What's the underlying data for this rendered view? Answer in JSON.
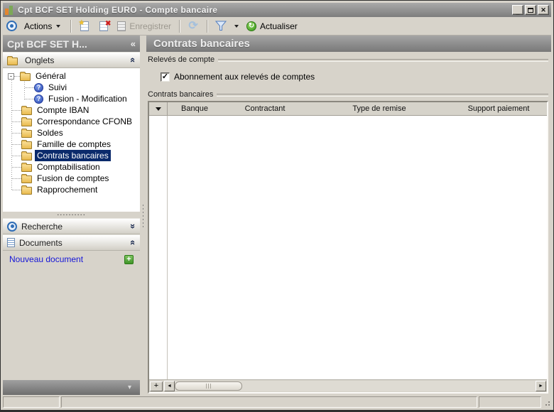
{
  "window": {
    "title": "Cpt BCF SET Holding EURO -  Compte bancaire"
  },
  "toolbar": {
    "actions_label": "Actions",
    "save_label": "Enregistrer",
    "actualiser_label": "Actualiser"
  },
  "sidebar": {
    "header_title": "Cpt BCF SET H...",
    "sections": {
      "onglets": "Onglets",
      "recherche": "Recherche",
      "documents": "Documents"
    },
    "tree": [
      {
        "id": "general",
        "label": "Général",
        "icon": "folder",
        "level": 0,
        "expander": true,
        "selected": false
      },
      {
        "id": "suivi",
        "label": "Suivi",
        "icon": "help",
        "level": 1,
        "expander": false,
        "selected": false
      },
      {
        "id": "fusion-modification",
        "label": "Fusion - Modification",
        "icon": "help",
        "level": 1,
        "expander": false,
        "selected": false
      },
      {
        "id": "compte-iban",
        "label": "Compte IBAN",
        "icon": "folder",
        "level": 0,
        "expander": false,
        "selected": false
      },
      {
        "id": "correspondance-cfonb",
        "label": "Correspondance CFONB",
        "icon": "folder",
        "level": 0,
        "expander": false,
        "selected": false
      },
      {
        "id": "soldes",
        "label": "Soldes",
        "icon": "folder",
        "level": 0,
        "expander": false,
        "selected": false
      },
      {
        "id": "famille-de-comptes",
        "label": "Famille de comptes",
        "icon": "folder",
        "level": 0,
        "expander": false,
        "selected": false
      },
      {
        "id": "contrats-bancaires",
        "label": "Contrats bancaires",
        "icon": "folder",
        "level": 0,
        "expander": false,
        "selected": true
      },
      {
        "id": "comptabilisation",
        "label": "Comptabilisation",
        "icon": "folder",
        "level": 0,
        "expander": false,
        "selected": false
      },
      {
        "id": "fusion-de-comptes",
        "label": "Fusion de comptes",
        "icon": "folder",
        "level": 0,
        "expander": false,
        "selected": false
      },
      {
        "id": "rapprochement",
        "label": "Rapprochement",
        "icon": "folder",
        "level": 0,
        "expander": false,
        "selected": false
      }
    ],
    "documents_links": {
      "nouveau": "Nouveau document"
    }
  },
  "main": {
    "header_title": "Contrats bancaires",
    "releves": {
      "label": "Relevés de compte",
      "checkbox_label": "Abonnement aux relevés de comptes",
      "checked": true
    },
    "contrats": {
      "label": "Contrats bancaires"
    },
    "table": {
      "columns": [
        "Banque",
        "Contractant",
        "Type de remise",
        "Support paiement"
      ],
      "rows": []
    }
  },
  "glyphs": {
    "minimize": "_",
    "close": "✕",
    "collapse_left": "«",
    "chevron_double_up": "«",
    "chevron_double_down": "»",
    "panel_collapse_down": "▾",
    "expander_minus": "-",
    "help": "?",
    "star": "★",
    "delete_x": "✖",
    "refresh": "⟳",
    "actualiser_arrow": "↻",
    "plus": "+",
    "check": "✓",
    "scroll_left": "◄",
    "scroll_right": "►",
    "splitter_dots": ".........."
  },
  "colors": {
    "selection": "#0b2a6b",
    "link": "#1616d8",
    "accent_green": "#3f9428",
    "header_gray": "#8a8a8a",
    "background": "#d7d3ca"
  }
}
